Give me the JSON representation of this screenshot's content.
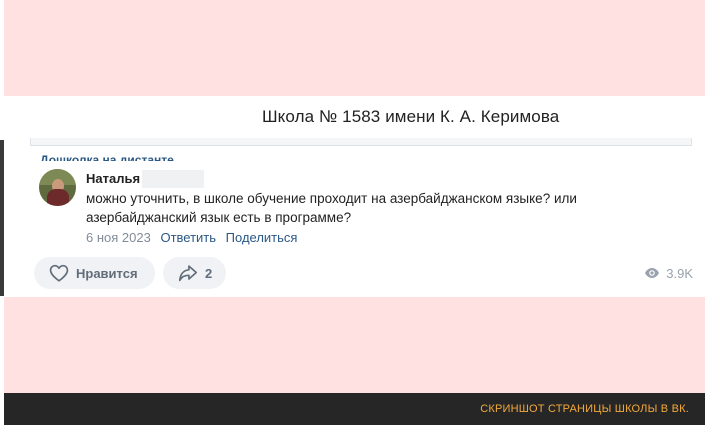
{
  "header": {
    "title": "Школа № 1583 имени К. А. Керимова"
  },
  "previous_post": {
    "link_text": "Дошколка на дистанте"
  },
  "comment": {
    "author": "Наталья",
    "text": "можно уточнить, в школе обучение проходит на азербайджанском языке? или азербайджанский язык есть в программе?",
    "date": "6 ноя 2023",
    "reply_label": "Ответить",
    "share_label": "Поделиться"
  },
  "actions": {
    "like_label": "Нравится",
    "share_count": "2",
    "views": "3.9K"
  },
  "footer": {
    "caption": "СКРИНШОТ СТРАНИЦЫ ШКОЛЫ В ВК."
  },
  "colors": {
    "background_pink": "#ffe1e1",
    "link_blue": "#2a5885",
    "caption_orange": "#f2a93b",
    "footer_dark": "#262626"
  },
  "icons": [
    "heart-icon",
    "share-arrow-icon",
    "eye-icon"
  ]
}
